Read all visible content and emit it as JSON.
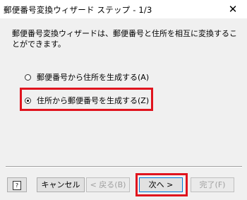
{
  "window": {
    "title": "郵便番号変換ウィザード ステップ - 1/3",
    "close_glyph": "✕"
  },
  "description": "郵便番号変換ウィザードは、郵便番号と住所を相互に変換することができます。",
  "options": [
    {
      "label": "郵便番号から住所を生成する(A)",
      "checked": false
    },
    {
      "label": "住所から郵便番号を生成する(Z)",
      "checked": true
    }
  ],
  "buttons": {
    "help_label": "?",
    "cancel_label": "キャンセル",
    "back_label": "< 戻る(B)",
    "next_label": "次へ >",
    "finish_label": "完了(F)"
  },
  "colors": {
    "highlight": "#e0141e",
    "window_bg": "#f0f0f0"
  },
  "icons": [
    "close-icon",
    "help-icon",
    "radio-icon"
  ]
}
